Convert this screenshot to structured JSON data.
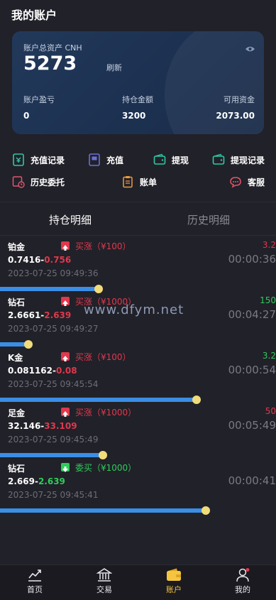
{
  "page_title": "我的账户",
  "asset_card": {
    "label": "账户总资产 CNH",
    "total": "5273",
    "refresh_label": "刷新",
    "stats": [
      {
        "label": "账户盈亏",
        "value": "0"
      },
      {
        "label": "持仓金额",
        "value": "3200"
      },
      {
        "label": "可用资金",
        "value": "2073.00"
      }
    ]
  },
  "quick_actions": [
    {
      "label": "充值记录",
      "icon": "recharge-record-icon",
      "color": "#2ec9a4"
    },
    {
      "label": "充值",
      "icon": "recharge-icon",
      "color": "#6b6fd6"
    },
    {
      "label": "提现",
      "icon": "withdraw-wallet-icon",
      "color": "#2ec9a4"
    },
    {
      "label": "提现记录",
      "icon": "withdraw-record-icon",
      "color": "#2ec9a4"
    },
    {
      "label": "历史委托",
      "icon": "history-orders-icon",
      "color": "#e0566b"
    },
    {
      "label": "账单",
      "icon": "bill-icon",
      "color": "#f09a3e"
    },
    {
      "label": "客服",
      "icon": "customer-service-icon",
      "color": "#e0566b"
    }
  ],
  "tabs": [
    "持仓明细",
    "历史明细"
  ],
  "positions": [
    {
      "name": "铂金",
      "direction": "买涨（¥100）",
      "dir_type": "up",
      "price_base": "0.7416-",
      "price_change": "0.756",
      "change_color": "#e0384c",
      "time": "2023-07-25 09:49:36",
      "pnl": "3.2",
      "pnl_color": "#e0384c",
      "countdown": "00:00:36",
      "progress": 0.42
    },
    {
      "name": "钻石",
      "direction": "买涨（¥1000）",
      "dir_type": "up",
      "price_base": "2.6661-",
      "price_change": "2.639",
      "change_color": "#e0384c",
      "time": "2023-07-25 09:49:27",
      "pnl": "150",
      "pnl_color": "#2ecc5a",
      "countdown": "00:04:27",
      "progress": 0.12
    },
    {
      "name": "K金",
      "direction": "买涨（¥100）",
      "dir_type": "up",
      "price_base": "0.081162-",
      "price_change": "0.08",
      "change_color": "#e0384c",
      "time": "2023-07-25 09:45:54",
      "pnl": "3.2",
      "pnl_color": "#2ecc5a",
      "countdown": "00:00:54",
      "progress": 0.84
    },
    {
      "name": "足金",
      "direction": "买涨（¥1000）",
      "dir_type": "up",
      "price_base": "32.146-",
      "price_change": "33.109",
      "change_color": "#e0384c",
      "time": "2023-07-25 09:45:49",
      "pnl": "50",
      "pnl_color": "#e0384c",
      "countdown": "00:05:49",
      "progress": 0.44
    },
    {
      "name": "钻石",
      "direction": "委买（¥1000）",
      "dir_type": "down",
      "price_base": "2.669-",
      "price_change": "2.639",
      "change_color": "#2ecc5a",
      "time": "2023-07-25 09:45:41",
      "pnl": "",
      "pnl_color": "#2ecc5a",
      "countdown": "00:00:41",
      "progress": 0.88
    }
  ],
  "watermark": "www.dfym.net",
  "bottom_nav": [
    {
      "label": "首页",
      "icon": "home-chart-icon",
      "active": false
    },
    {
      "label": "交易",
      "icon": "bank-icon",
      "active": false
    },
    {
      "label": "账户",
      "icon": "wallet-icon",
      "active": true
    },
    {
      "label": "我的",
      "icon": "user-icon",
      "active": false
    }
  ],
  "colors": {
    "accent": "#f5c542",
    "up": "#e0384c",
    "down": "#2ecc5a",
    "bar": "#3a8ee6"
  }
}
